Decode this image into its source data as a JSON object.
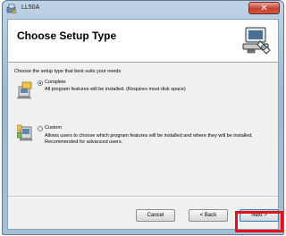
{
  "window": {
    "title": "LL50A",
    "close_label": "✕"
  },
  "banner": {
    "title": "Choose Setup Type"
  },
  "setup": {
    "prompt": "Choose the setup type that best suits your needs",
    "options": [
      {
        "label": "Complete",
        "description": "All program features will be installed. (Requires most disk space)",
        "selected": true
      },
      {
        "label": "Custom",
        "description": "Allows users to choose which program features will be installed and where they will be installed. Recommended for advanced users.",
        "selected": false
      }
    ]
  },
  "buttons": {
    "cancel": "Cancel",
    "back": "< Back",
    "next": "Next >"
  },
  "colors": {
    "highlight": "#e0101c",
    "accent": "#1a4fb8"
  }
}
